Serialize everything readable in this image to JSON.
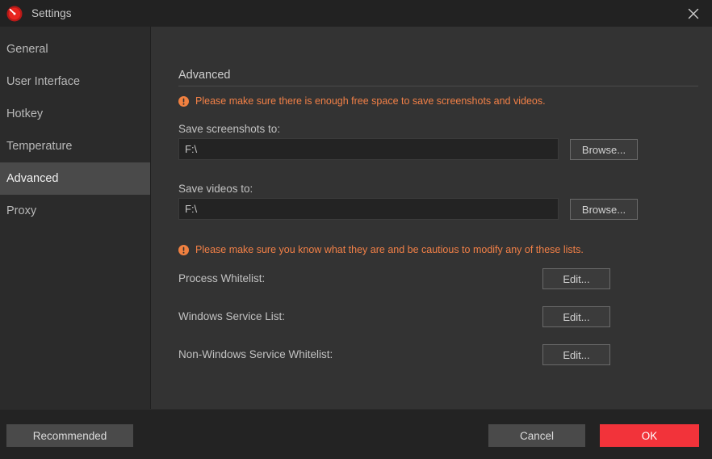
{
  "window": {
    "title": "Settings",
    "app_icon": "gauge-icon",
    "close_icon": "close-icon"
  },
  "sidebar": {
    "items": [
      {
        "label": "General",
        "selected": false
      },
      {
        "label": "User Interface",
        "selected": false
      },
      {
        "label": "Hotkey",
        "selected": false
      },
      {
        "label": "Temperature",
        "selected": false
      },
      {
        "label": "Advanced",
        "selected": true
      },
      {
        "label": "Proxy",
        "selected": false
      }
    ]
  },
  "content": {
    "heading": "Advanced",
    "warning_storage": {
      "icon": "warning-icon",
      "text": "Please make sure there is enough free space to save screenshots and videos."
    },
    "screenshots": {
      "label": "Save screenshots to:",
      "value": "F:\\",
      "placeholder": "",
      "browse_label": "Browse..."
    },
    "videos": {
      "label": "Save videos to:",
      "value": "F:\\",
      "placeholder": "",
      "browse_label": "Browse..."
    },
    "warning_lists": {
      "icon": "warning-icon",
      "text": "Please make sure you know what they are and be cautious to modify any of these lists."
    },
    "lists": [
      {
        "label": "Process Whitelist:",
        "button": "Edit..."
      },
      {
        "label": "Windows Service List:",
        "button": "Edit..."
      },
      {
        "label": "Non-Windows Service Whitelist:",
        "button": "Edit..."
      }
    ]
  },
  "footer": {
    "recommended_label": "Recommended",
    "cancel_label": "Cancel",
    "ok_label": "OK"
  },
  "colors": {
    "accent_red": "#f2333a",
    "warning_orange": "#f28047",
    "selected_gray": "#4a4a4a"
  }
}
